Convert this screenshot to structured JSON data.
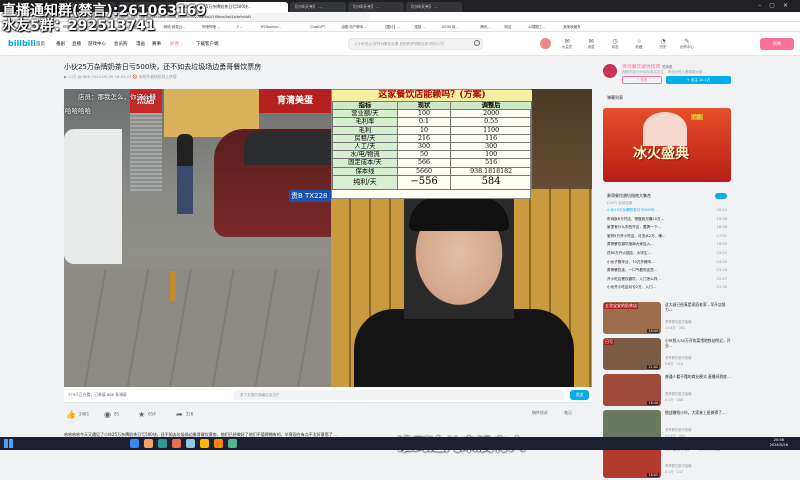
{
  "overlay": {
    "line1": "直播通知群(禁言):261063169",
    "line2": "水友5群：292513741"
  },
  "browser": {
    "tabs": [
      "(1) 【你好】 ...",
      "(中) 【天寺】...",
      "(bilibili) 小伙25万杂牌奶茶日亏500块...",
      "【小伙天寺】 ...",
      "【小伙天寺】 ...",
      "【小伙天寺】 ..."
    ],
    "address": "bilibili.com/video/BV1ap4y1E7ah?spm_id_from=333.788.player.switch&vd_source=0278af6a2f1f9bba3dd1b4e9d4d5",
    "bookmarks": [
      "bilibili",
      "通联...",
      "哔哩哔哩...",
      "网络交易...",
      "Q 百度一下...",
      "网络·网易云...",
      "哔哩哔哩 ...",
      "Y ...",
      "RSToolbar...",
      "ChatGPT",
      "油猴·用户脚本...",
      "【图片】...",
      "搜狐 ...",
      "JSON 到...",
      "腾讯...",
      "网站",
      "AI搜图工...",
      "其他收藏夹"
    ]
  },
  "header": {
    "logo": "bilibili",
    "nav": [
      "首页",
      "番剧",
      "直播",
      "游戏中心",
      "会员购",
      "漫画",
      "赛事",
      "新春",
      "下载客户端"
    ],
    "search_placeholder": "儿十秒边以-好好对象初反看 赶回有梦想到目到 的内人付",
    "icons": [
      {
        "glyph": "✉",
        "label": "大会员"
      },
      {
        "glyph": "✉",
        "label": "消息"
      },
      {
        "glyph": "◷",
        "label": "动态"
      },
      {
        "glyph": "☆",
        "label": "收藏"
      },
      {
        "glyph": "◔",
        "label": "历史"
      },
      {
        "glyph": "✎",
        "label": "创作中心"
      }
    ],
    "upload": "投稿"
  },
  "video": {
    "title": "小伙25万杂牌奶茶日亏500块，还不如去垃圾场边勇哥餐饮票房",
    "meta": "▶ 13万   ▤ 886   2024-05-26 16:04:23   🚫 未经作者授权禁止转载",
    "left_caption": "店员：那我怎么，你这么赚",
    "left_caption2": "哈哈哈哈",
    "sign_left": "杰店",
    "sign_right": "育清美蛋",
    "plate": "贵B TX228",
    "subtitle": "谁到这儿来没有人",
    "table_title": "这家餐饮店能赖吗？(方案)",
    "table_headers": [
      "指标",
      "现状",
      "调整后"
    ],
    "table_rows": [
      [
        "营业额/天",
        "100",
        "2000"
      ],
      [
        "毛利率",
        "0.1",
        "0.55"
      ],
      [
        "毛利",
        "10",
        "1100"
      ],
      [
        "房租/天",
        "216",
        "116"
      ],
      [
        "人工/天",
        "300",
        "300"
      ],
      [
        "水/电/物流",
        "50",
        "100"
      ],
      [
        "固定成本/天",
        "566",
        "516"
      ],
      [
        "保本线",
        "5660",
        "938.1818182"
      ],
      [
        "纯利/天",
        "−556",
        "584"
      ]
    ]
  },
  "player_bar": {
    "viewers": "379人正在看，已装填 886 条弹幕",
    "dm_placeholder": "发个友善的弹幕见证当下",
    "send": "发送"
  },
  "actions": [
    {
      "icon": "thumb-up-icon",
      "glyph": "👍",
      "count": "2461"
    },
    {
      "icon": "coin-icon",
      "glyph": "◉",
      "count": "85"
    },
    {
      "icon": "star-icon",
      "glyph": "★",
      "count": "654"
    },
    {
      "icon": "share-icon",
      "glyph": "➦",
      "count": "326"
    }
  ],
  "right_actions": [
    "稿件投诉",
    "笔记"
  ],
  "desc": "哈哈哈哈今天又遇见了小伙25万杂牌奶茶日亏500块，还不如去垃圾场边勇哥餐饮票房，他们已经做好了他们不值得拥有的，毕竟现在有点不太好意思了 ...",
  "up": {
    "name": "勇哥餐饮避坑指南",
    "tag": "发消息",
    "desc": "视频内容均为实际真实发生，请勿对号入座感谢大家…",
    "charge": "⚡ 充电",
    "follow": "+ 关注 10.1万"
  },
  "dm_panel": "弹幕列表",
  "ad": {
    "title": "冰火盛典",
    "tag": "广告"
  },
  "collection": {
    "title": "勇哥餐饮避坑指南大集合",
    "sub": "(1/47)  自动连播",
    "items": [
      {
        "t": "小伙25万杂牌奶茶日亏500块...",
        "d": "20:12",
        "on": true
      },
      {
        "t": "杀鸡饭6万开店，想做到月赚10万...",
        "d": "19:46",
        "on": false
      },
      {
        "t": "家里有什么东西开店，要搞一个...",
        "d": "18:28",
        "on": false
      },
      {
        "t": "宝妈5万开小吃店，月流水2万，赚...",
        "d": "17:31",
        "on": false
      },
      {
        "t": "勇哥餐饮避坑指南大家加入...",
        "d": "16:09",
        "on": false
      },
      {
        "t": "花60万开火锅店，大学生...",
        "d": "15:22",
        "on": false
      },
      {
        "t": "小伙子刚毕业，70万开烤肉...",
        "d": "14:55",
        "on": false
      },
      {
        "t": "勇哥餐饮走，一口气看完这些...",
        "d": "13:18",
        "on": false
      },
      {
        "t": "开小吃店餐饮避坑，入门怎么样...",
        "d": "12:47",
        "on": false
      },
      {
        "t": "小伙开小吃店月亏2万，入门...",
        "d": "11:30",
        "on": false
      }
    ]
  },
  "recommendations": [
    {
      "title": "这大叔已经真是家庭老家...早开店努力...",
      "up": "勇哥餐饮避坑指南",
      "stats": "13.8万 · 392",
      "dur": "19:45",
      "color": "#9c6e4e"
    },
    {
      "title": "小伙投入30万开的菜馆地铁站附近，开业...",
      "up": "勇哥餐饮避坑指南",
      "stats": "9.6万 · 216",
      "dur": "21:02",
      "color": "#7b5c44"
    },
    {
      "title": "普通人看不懂的商业模式 直播间到底…",
      "up": "勇哥餐饮避坑指南",
      "stats": "6.3万 · 188",
      "dur": "16:40",
      "color": "#a04a3c"
    },
    {
      "title": "挑战赚钱小伙，大家来上班做得了...",
      "up": "勇哥餐饮避坑指南",
      "stats": "11.2万 · 305",
      "dur": "22:18",
      "color": "#6b7a5e"
    },
    {
      "title": "两口去做早餐，一个月可以拿到多少...",
      "up": "勇哥餐饮避坑指南",
      "stats": "8.1万 · 147",
      "dur": "18:05",
      "color": "#b23b2e"
    }
  ],
  "recommendation_badges": [
    "五花宝安的奶茶店",
    "日亏"
  ],
  "taskbar": {
    "time": "20:56",
    "date": "2024/5/26"
  }
}
